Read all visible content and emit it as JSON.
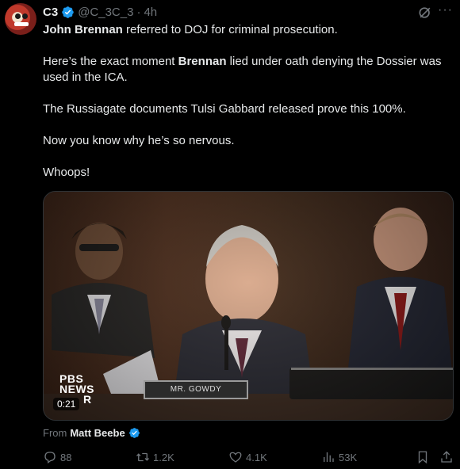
{
  "tweet": {
    "author_name": "C3",
    "handle": "@C_3C_3",
    "separator": "·",
    "time": "4h",
    "text_p1_bold": "John Brennan",
    "text_p1_rest": " referred to DOJ for criminal prosecution.",
    "text_p2_a": "Here’s the exact moment ",
    "text_p2_bold": "Brennan",
    "text_p2_b": " lied under oath denying the Dossier was used in the ICA.",
    "text_p3": "The Russiagate documents Tulsi Gabbard released prove this 100%.",
    "text_p4": "Now you know why he’s so nervous.",
    "text_p5": "Whoops!"
  },
  "video": {
    "logo_line1": "PBS",
    "logo_line2": "NEWS",
    "logo_suffix": "R",
    "nameplate": "MR. GOWDY",
    "timestamp": "0:21"
  },
  "source": {
    "prefix": "From",
    "name": "Matt Beebe"
  },
  "actions": {
    "replies": "88",
    "reposts": "1.2K",
    "likes": "4.1K",
    "views": "53K"
  },
  "icons": {
    "verified": "verified-badge-icon",
    "grok": "grok-icon",
    "more": "more-icon",
    "reply": "reply-icon",
    "repost": "repost-icon",
    "like": "heart-icon",
    "views": "views-chart-icon",
    "bookmark": "bookmark-icon",
    "share": "share-icon"
  },
  "colors": {
    "verified_blue": "#1d9bf0",
    "secondary_text": "#71767b",
    "background": "#000000"
  }
}
